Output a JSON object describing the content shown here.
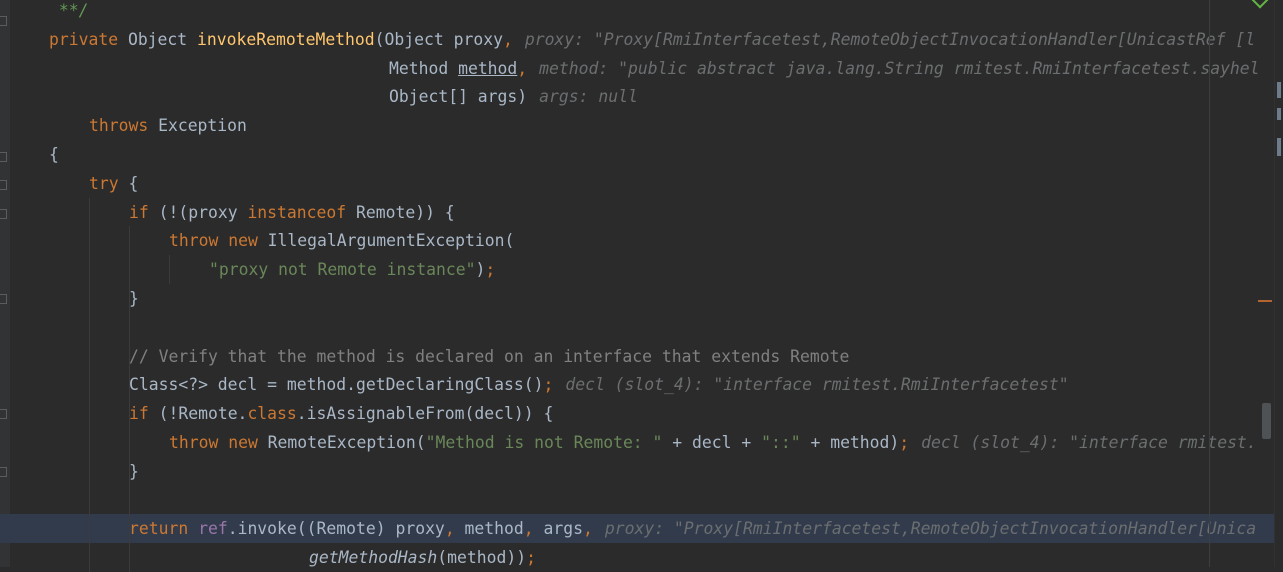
{
  "editor": {
    "lines": [
      {
        "tokens": [
          {
            "t": " **/",
            "c": "doc"
          }
        ]
      },
      {
        "tokens": [
          {
            "t": "private",
            "c": "kw"
          },
          {
            "t": " Object "
          },
          {
            "t": "invokeRemoteMethod",
            "c": "fn"
          },
          {
            "t": "(Object proxy"
          },
          {
            "t": ",",
            "c": "kw"
          }
        ],
        "hint": "proxy: \"Proxy[RmiInterfacetest,RemoteObjectInvocationHandler[UnicastRef [l"
      },
      {
        "tokens": [
          {
            "t": "Method "
          },
          {
            "t": "method",
            "c": "ul"
          },
          {
            "t": ",",
            "c": "kw"
          }
        ],
        "hint": "method: \"public abstract java.lang.String rmitest.RmiInterfacetest.sayhel"
      },
      {
        "tokens": [
          {
            "t": "Object[] args)"
          }
        ],
        "hint": "args: null"
      },
      {
        "tokens": [
          {
            "t": "throws",
            "c": "kw"
          },
          {
            "t": " Exception"
          }
        ]
      },
      {
        "tokens": [
          {
            "t": "{"
          }
        ]
      },
      {
        "tokens": [
          {
            "t": "try",
            "c": "kw"
          },
          {
            "t": " {"
          }
        ]
      },
      {
        "tokens": [
          {
            "t": "if",
            "c": "kw"
          },
          {
            "t": " (!(proxy "
          },
          {
            "t": "instanceof",
            "c": "kw"
          },
          {
            "t": " Remote)) {"
          }
        ]
      },
      {
        "tokens": [
          {
            "t": "throw new",
            "c": "kw"
          },
          {
            "t": " IllegalArgumentException("
          }
        ]
      },
      {
        "tokens": [
          {
            "t": "\"proxy not Remote instance\"",
            "c": "str"
          },
          {
            "t": ")"
          },
          {
            "t": ";",
            "c": "kw"
          }
        ]
      },
      {
        "tokens": [
          {
            "t": "}"
          }
        ]
      },
      {
        "tokens": []
      },
      {
        "tokens": [
          {
            "t": "// Verify that the method is declared on an interface that extends Remote",
            "c": "cm"
          }
        ]
      },
      {
        "tokens": [
          {
            "t": "Class<?> decl = method.getDeclaringClass()"
          },
          {
            "t": ";",
            "c": "kw"
          }
        ],
        "hint": "decl (slot_4): \"interface rmitest.RmiInterfacetest\""
      },
      {
        "tokens": [
          {
            "t": "if",
            "c": "kw"
          },
          {
            "t": " (!Remote."
          },
          {
            "t": "class",
            "c": "kw"
          },
          {
            "t": ".isAssignableFrom(decl)) {"
          }
        ]
      },
      {
        "tokens": [
          {
            "t": "throw new",
            "c": "kw"
          },
          {
            "t": " RemoteException("
          },
          {
            "t": "\"Method is not Remote: \"",
            "c": "str"
          },
          {
            "t": " + decl + "
          },
          {
            "t": "\"::\"",
            "c": "str"
          },
          {
            "t": " + method)"
          },
          {
            "t": ";",
            "c": "kw"
          }
        ],
        "hint": "decl (slot_4): \"interface rmitest."
      },
      {
        "tokens": [
          {
            "t": "}"
          }
        ]
      },
      {
        "tokens": []
      },
      {
        "tokens": [
          {
            "t": "return",
            "c": "kw"
          },
          {
            "t": " "
          },
          {
            "t": "ref",
            "c": "fld"
          },
          {
            "t": ".invoke((Remote) proxy"
          },
          {
            "t": ",",
            "c": "kw"
          },
          {
            "t": " method"
          },
          {
            "t": ",",
            "c": "kw"
          },
          {
            "t": " args"
          },
          {
            "t": ",",
            "c": "kw"
          }
        ],
        "hint": "proxy: \"Proxy[RmiInterfacetest,RemoteObjectInvocationHandler[Unica"
      },
      {
        "tokens": [
          {
            "t": "getMethodHash",
            "c": "it"
          },
          {
            "t": "(method))"
          },
          {
            "t": ";",
            "c": "kw"
          }
        ]
      }
    ]
  },
  "colors": {
    "background": "#2b2b2b",
    "keyword": "#cc7832",
    "method_decl": "#ffc66d",
    "string": "#6a8759",
    "comment": "#808080",
    "field": "#9876aa",
    "inline_hint": "#6b6e70",
    "current_line": "#323b4b"
  }
}
